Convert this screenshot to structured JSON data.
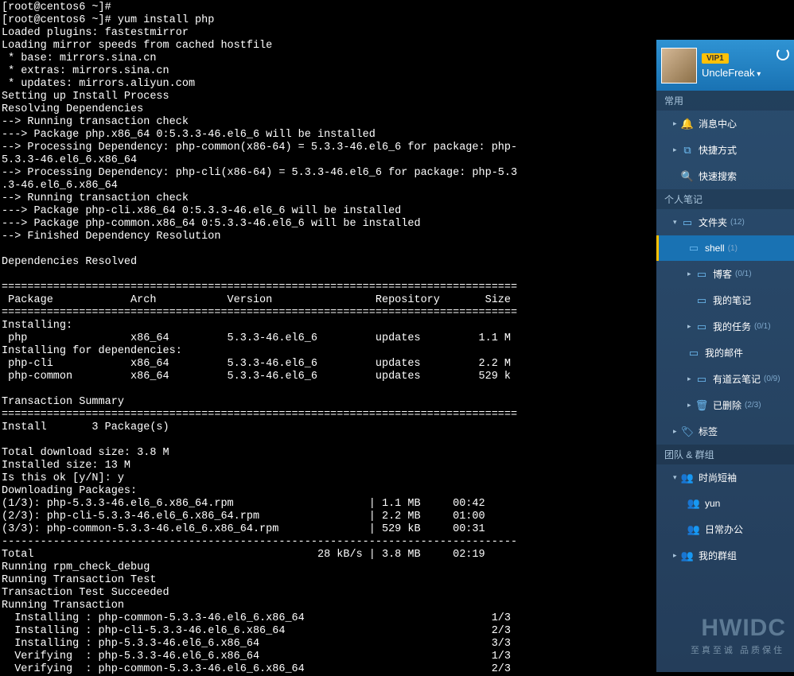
{
  "terminal_output": "[root@centos6 ~]#\n[root@centos6 ~]# yum install php\nLoaded plugins: fastestmirror\nLoading mirror speeds from cached hostfile\n * base: mirrors.sina.cn\n * extras: mirrors.sina.cn\n * updates: mirrors.aliyun.com\nSetting up Install Process\nResolving Dependencies\n--> Running transaction check\n---> Package php.x86_64 0:5.3.3-46.el6_6 will be installed\n--> Processing Dependency: php-common(x86-64) = 5.3.3-46.el6_6 for package: php-\n5.3.3-46.el6_6.x86_64\n--> Processing Dependency: php-cli(x86-64) = 5.3.3-46.el6_6 for package: php-5.3\n.3-46.el6_6.x86_64\n--> Running transaction check\n---> Package php-cli.x86_64 0:5.3.3-46.el6_6 will be installed\n---> Package php-common.x86_64 0:5.3.3-46.el6_6 will be installed\n--> Finished Dependency Resolution\n\nDependencies Resolved\n\n================================================================================\n Package            Arch           Version                Repository       Size\n================================================================================\nInstalling:\n php                x86_64         5.3.3-46.el6_6         updates         1.1 M\nInstalling for dependencies:\n php-cli            x86_64         5.3.3-46.el6_6         updates         2.2 M\n php-common         x86_64         5.3.3-46.el6_6         updates         529 k\n\nTransaction Summary\n================================================================================\nInstall       3 Package(s)\n\nTotal download size: 3.8 M\nInstalled size: 13 M\nIs this ok [y/N]: y\nDownloading Packages:\n(1/3): php-5.3.3-46.el6_6.x86_64.rpm                     | 1.1 MB     00:42\n(2/3): php-cli-5.3.3-46.el6_6.x86_64.rpm                 | 2.2 MB     01:00\n(3/3): php-common-5.3.3-46.el6_6.x86_64.rpm              | 529 kB     00:31\n--------------------------------------------------------------------------------\nTotal                                            28 kB/s | 3.8 MB     02:19\nRunning rpm_check_debug\nRunning Transaction Test\nTransaction Test Succeeded\nRunning Transaction\n  Installing : php-common-5.3.3-46.el6_6.x86_64                             1/3\n  Installing : php-cli-5.3.3-46.el6_6.x86_64                                2/3\n  Installing : php-5.3.3-46.el6_6.x86_64                                    3/3\n  Verifying  : php-5.3.3-46.el6_6.x86_64                                    1/3\n  Verifying  : php-common-5.3.3-46.el6_6.x86_64                             2/3",
  "user": {
    "vip_label": "VIP1",
    "name": "UncleFreak"
  },
  "sections": {
    "common": "常用",
    "personal_notes": "个人笔记",
    "teams": "团队 & 群组"
  },
  "common_items": {
    "msg_center": "消息中心",
    "shortcuts": "快捷方式",
    "quick_search": "快速搜索"
  },
  "notes": {
    "folder": "文件夹",
    "folder_count": "(12)",
    "shell": "shell",
    "shell_count": "(1)",
    "blog": "博客",
    "blog_count": "(0/1)",
    "my_notes": "我的笔记",
    "my_tasks": "我的任务",
    "my_tasks_count": "(0/1)",
    "my_mail": "我的邮件",
    "youdao": "有道云笔记",
    "youdao_count": "(0/9)",
    "deleted": "已删除",
    "deleted_count": "(2/3)",
    "tags": "标签"
  },
  "teams": {
    "fashion": "时尚短袖",
    "yun": "yun",
    "daily_office": "日常办公",
    "my_groups": "我的群组"
  },
  "logo": "HWIDC",
  "tagline": "至真至诚 品质保住"
}
